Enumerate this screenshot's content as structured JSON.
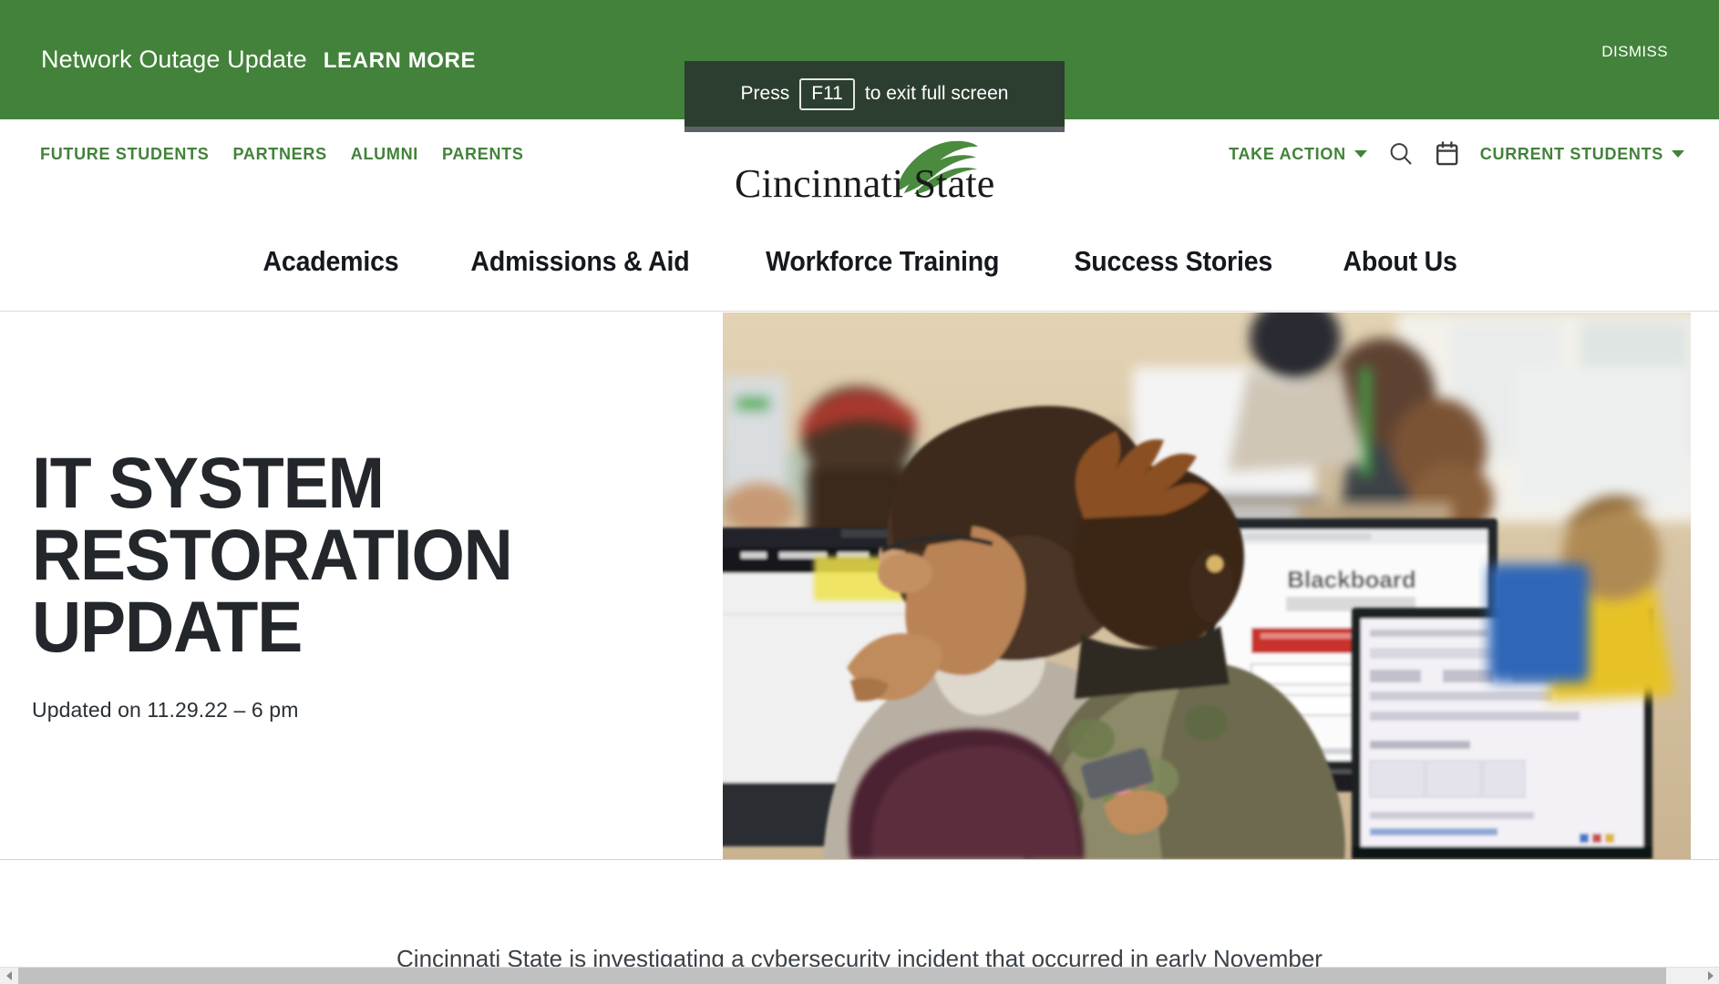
{
  "alert": {
    "title": "Network Outage Update",
    "cta": "LEARN MORE",
    "dismiss": "DISMISS",
    "bg_color": "#42823a"
  },
  "fullscreen_toast": {
    "prefix": "Press",
    "key": "F11",
    "suffix": "to exit full screen",
    "bg_color": "#2c3e30"
  },
  "utility_nav": {
    "links": [
      {
        "label": "FUTURE STUDENTS"
      },
      {
        "label": "PARTNERS"
      },
      {
        "label": "ALUMNI"
      },
      {
        "label": "PARENTS"
      }
    ],
    "take_action": "TAKE ACTION",
    "current_students": "CURRENT STUDENTS",
    "search_icon": "search-icon",
    "calendar_icon": "calendar-icon",
    "link_color": "#42823a"
  },
  "logo": {
    "wordmark": "Cincinnati State",
    "leaf_icon": "leaf-swoosh-icon",
    "leaf_color": "#4a8b3f"
  },
  "primary_nav": {
    "items": [
      {
        "label": "Academics"
      },
      {
        "label": "Admissions & Aid"
      },
      {
        "label": "Workforce Training"
      },
      {
        "label": "Success Stories"
      },
      {
        "label": "About Us"
      }
    ]
  },
  "hero": {
    "title": "IT SYSTEM RESTORATION UPDATE",
    "subtitle": "Updated on 11.29.22 – 6 pm",
    "photo_alt": "Students working at computers in a campus computer lab"
  },
  "body": {
    "paragraph": "Cincinnati State is investigating a cybersecurity incident that occurred in early November"
  },
  "scrollbar": {
    "left_arrow": "scroll-left-icon",
    "right_arrow": "scroll-right-icon"
  }
}
